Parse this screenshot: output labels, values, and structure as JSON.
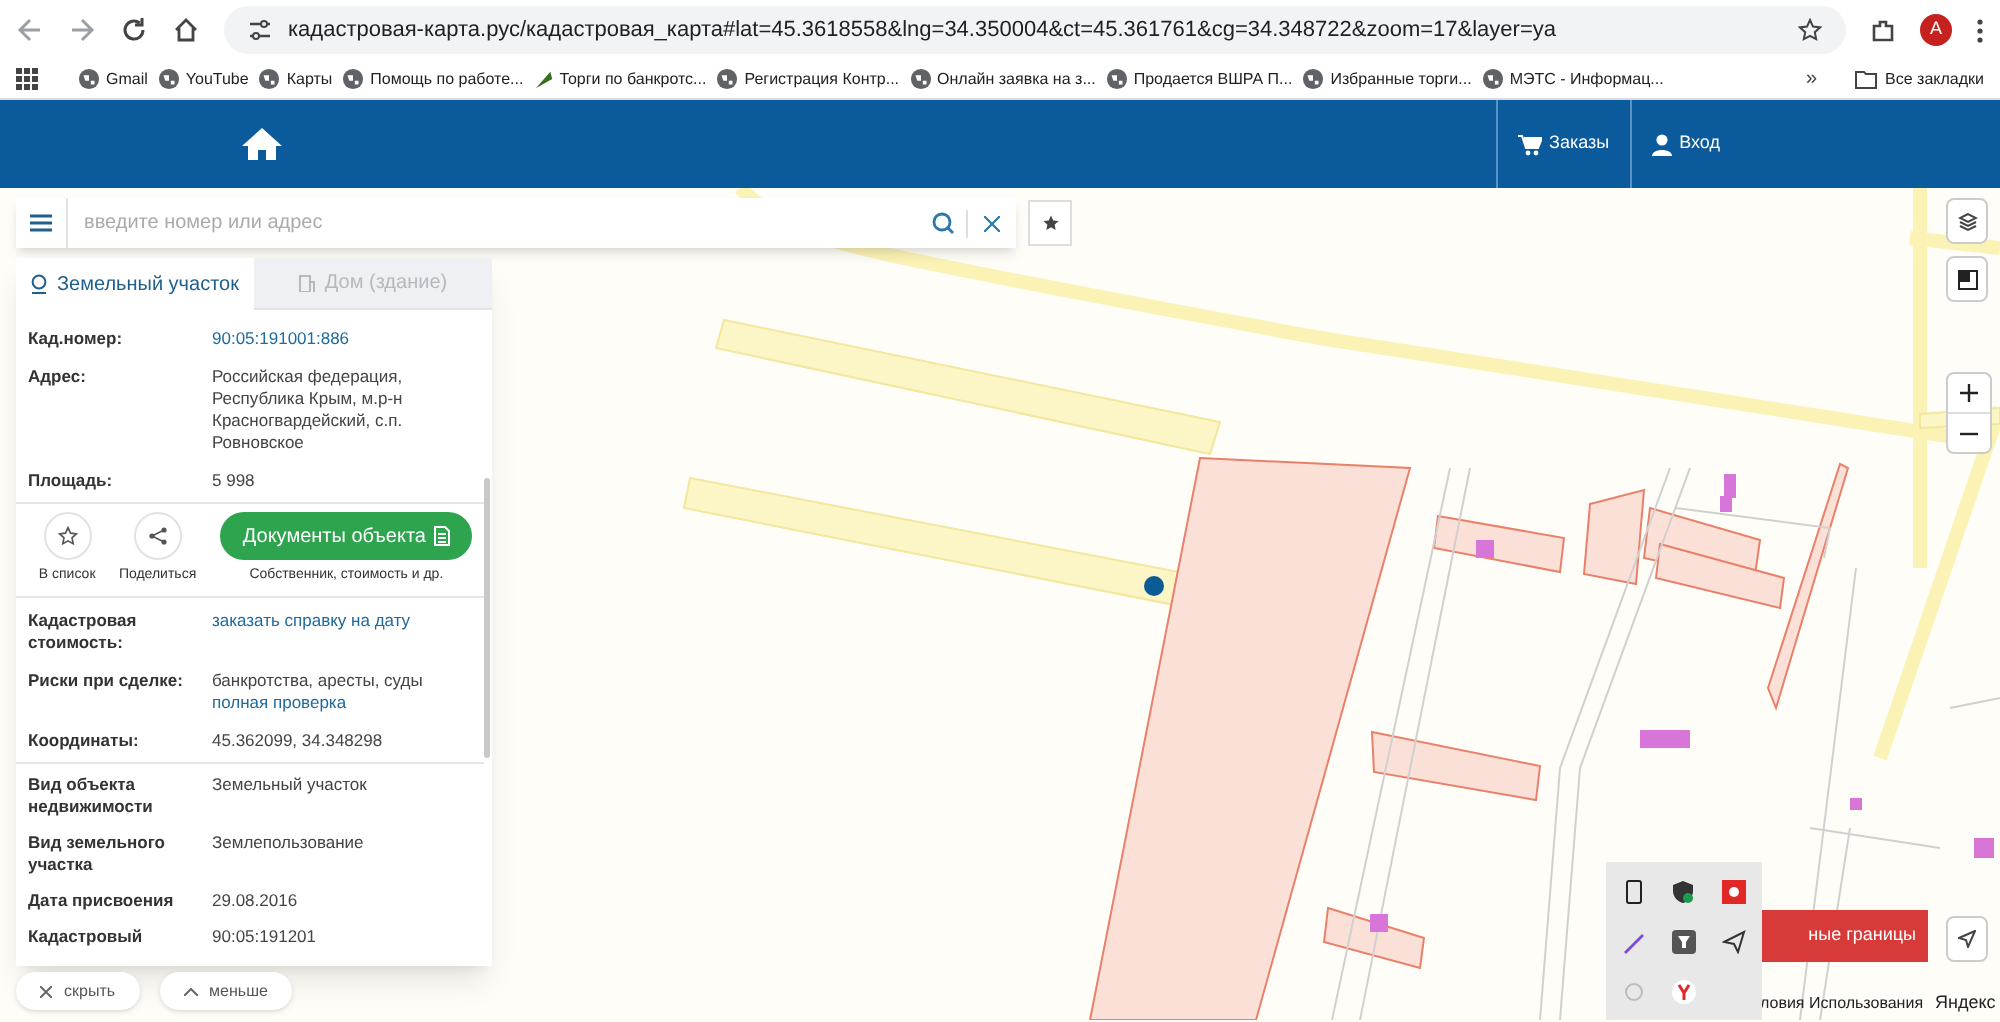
{
  "browser": {
    "url": "кадастровая-карта.рус/кадастровая_карта#lat=45.3618558&lng=34.350004&ct=45.361761&cg=34.348722&zoom=17&layer=ya",
    "profile": "A",
    "bookmarks": [
      "Gmail",
      "YouTube",
      "Карты",
      "Помощь по работе...",
      "Торги по банкротс...",
      "Регистрация Контр...",
      "Онлайн заявка на з...",
      "Продается ВШРА П...",
      "Избранные торги...",
      "МЭТС - Информац..."
    ],
    "more": "»",
    "all_bookmarks": "Все закладки"
  },
  "header": {
    "nav": [
      {
        "kind": "cart",
        "label": "Заказы"
      },
      {
        "kind": "user",
        "label": "Вход"
      }
    ]
  },
  "search": {
    "placeholder": "введите номер или адрес"
  },
  "panel": {
    "tabs": [
      {
        "kind": "parcel",
        "label": "Земельный участок",
        "selected": true
      },
      {
        "kind": "house",
        "label": "Дом (здание)",
        "selected": false
      }
    ],
    "top_rows": [
      {
        "label": "Кад.номер:",
        "value": "90:05:191001:886",
        "link": true
      },
      {
        "label": "Адрес:",
        "value": "Российская федерация, Республика Крым, м.р-н Красногвардейский, с.п. Ровновское",
        "link": false
      },
      {
        "label": "Площадь:",
        "value": "5 998",
        "link": false
      }
    ],
    "actions": [
      {
        "kind": "star",
        "label": "В список"
      },
      {
        "kind": "share",
        "label": "Поделиться"
      }
    ],
    "documents_button": "Документы объекта",
    "documents_note": "Собственник, стоимость и др.",
    "mid_rows": [
      {
        "label": "Кадастровая стоимость:",
        "value": "заказать справку на дату",
        "link": true
      },
      {
        "label": "Риски при сделке:",
        "value": "банкротства, аресты, суды",
        "extra_link": "полная проверка",
        "link": false
      },
      {
        "label": "Координаты:",
        "value": "45.362099, 34.348298",
        "link": false
      }
    ],
    "bottom_rows": [
      {
        "label": "Вид объекта недвижимости",
        "value": "Земельный участок"
      },
      {
        "label": "Вид земельного участка",
        "value": "Землепользование"
      },
      {
        "label": "Дата присвоения",
        "value": "29.08.2016"
      },
      {
        "label": "Кадастровый",
        "value": "90:05:191201"
      }
    ]
  },
  "bottom_buttons": [
    {
      "kind": "close",
      "label": "скрыть"
    },
    {
      "kind": "up",
      "label": "меньше"
    }
  ],
  "map": {
    "boundaries_button": "ные границы",
    "terms": "ловия Использования",
    "brand": "Яндекс"
  }
}
